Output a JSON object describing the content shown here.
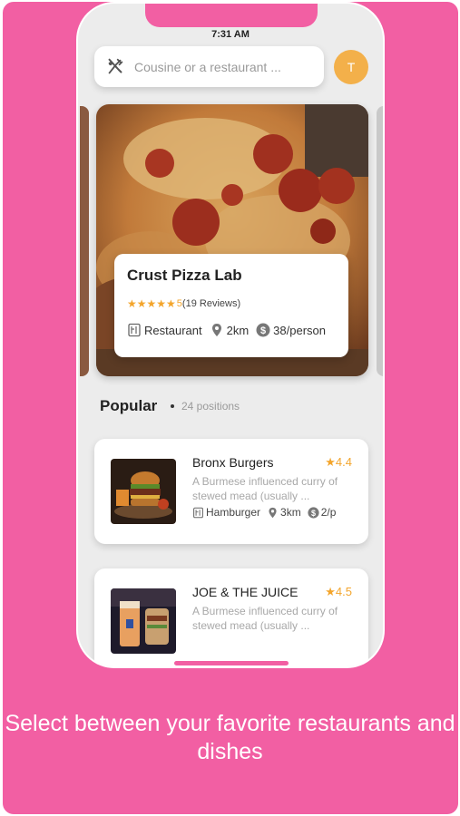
{
  "status_bar": {
    "time": "7:31 AM"
  },
  "search": {
    "placeholder": "Cousine or a restaurant ...",
    "value": ""
  },
  "user": {
    "avatar_initial": "T"
  },
  "featured": {
    "name": "Crust Pizza Lab",
    "stars": "★★★★★",
    "rating": "5",
    "reviews": "(19 Reviews)",
    "type": "Restaurant",
    "distance": "2km",
    "price": "38/person"
  },
  "popular": {
    "title": "Popular",
    "count": "24 positions"
  },
  "dishes": [
    {
      "name": "Bronx Burgers",
      "rating": "4.4",
      "description": "A Burmese influenced curry of stewed mead (usually ...",
      "type": "Hamburger",
      "distance": "3km",
      "price": "2/p"
    },
    {
      "name": "JOE & THE JUICE",
      "rating": "4.5",
      "description": "A Burmese influenced curry of stewed mead (usually ..."
    }
  ],
  "caption": "Select between your favorite restaurants and dishes",
  "colors": {
    "background": "#f25fa3",
    "accent": "#f3a52c",
    "avatar": "#f3b04a"
  },
  "icons": [
    "fork-knife-icon",
    "star-icon",
    "restaurant-icon",
    "location-pin-icon",
    "dollar-icon"
  ]
}
